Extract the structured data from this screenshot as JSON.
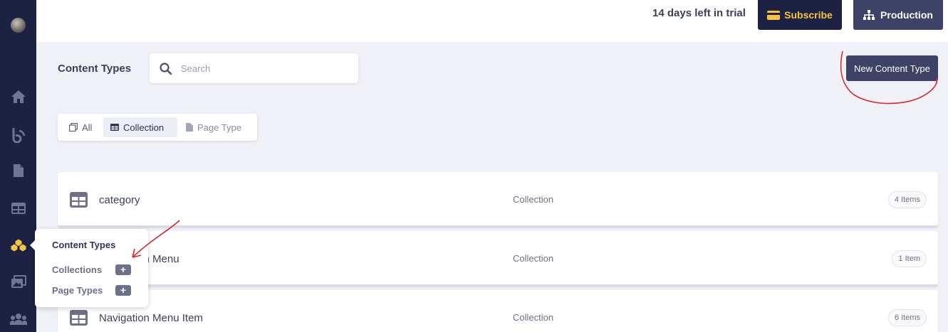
{
  "topbar": {
    "trial_text": "14 days left in trial",
    "subscribe_label": "Subscribe",
    "production_label": "Production"
  },
  "header": {
    "title": "Content Types",
    "search_placeholder": "Search",
    "search_value": "",
    "new_button": "New Content Type"
  },
  "filters": [
    {
      "label": "All",
      "icon": "copy-icon",
      "active": false
    },
    {
      "label": "Collection",
      "icon": "table-icon",
      "active": true
    },
    {
      "label": "Page Type",
      "icon": "document-icon",
      "active": false
    }
  ],
  "rows": [
    {
      "name": "category",
      "type": "Collection",
      "count": "4 Items"
    },
    {
      "name": "Navigation Menu",
      "type": "Collection",
      "count": "1 Item"
    },
    {
      "name": "Navigation Menu Item",
      "type": "Collection",
      "count": "6 Items"
    }
  ],
  "popup": {
    "title": "Content Types",
    "items": [
      {
        "label": "Collections"
      },
      {
        "label": "Page Types"
      }
    ]
  },
  "sidebar": {
    "items": [
      "avatar",
      "home-icon",
      "blog-icon",
      "document-icon",
      "table-icon",
      "content-types-icon",
      "media-icon",
      "users-icon"
    ]
  },
  "colors": {
    "sidebar_bg": "#1e2242",
    "accent_yellow": "#f6c443",
    "button_dark": "#3d4266",
    "annotation_red": "#d42a2a"
  }
}
